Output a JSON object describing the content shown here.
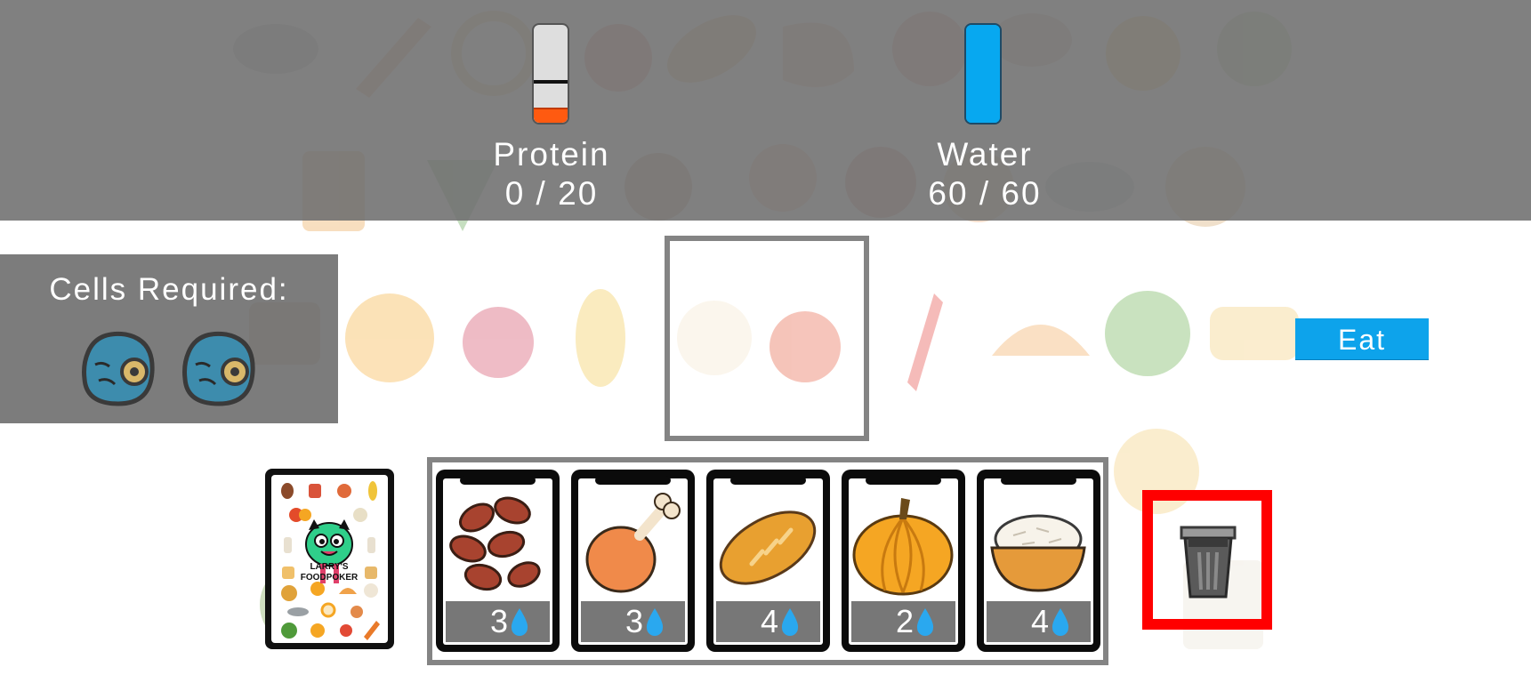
{
  "hud": {
    "protein": {
      "label": "Protein",
      "value_text": "0 / 20",
      "current": 0,
      "max": 20,
      "fill_fraction": 0.14,
      "target_marker_fraction": 0.56,
      "color": "#ff5a10"
    },
    "water": {
      "label": "Water",
      "value_text": "60 / 60",
      "current": 60,
      "max": 60,
      "fill_fraction": 1.0,
      "color": "#07a8f0"
    }
  },
  "cells_required": {
    "title": "Cells Required:",
    "icons": [
      "cell-icon",
      "cell-icon"
    ]
  },
  "play_area": {
    "icon": "empty-card-slot"
  },
  "eat_button": {
    "label": "Eat",
    "color": "#0da3eb"
  },
  "deck": {
    "logo_text_line1": "LARRY'S",
    "logo_text_line2": "FOODPOKER"
  },
  "hand": [
    {
      "food_icon": "kidney-beans-icon",
      "cost": "3",
      "cost_icon": "water-drop-icon"
    },
    {
      "food_icon": "chicken-drumstick-icon",
      "cost": "3",
      "cost_icon": "water-drop-icon"
    },
    {
      "food_icon": "bread-loaf-icon",
      "cost": "4",
      "cost_icon": "water-drop-icon"
    },
    {
      "food_icon": "pumpkin-icon",
      "cost": "2",
      "cost_icon": "water-drop-icon"
    },
    {
      "food_icon": "rice-bowl-icon",
      "cost": "4",
      "cost_icon": "water-drop-icon"
    }
  ],
  "discard": {
    "icon": "trash-can-icon",
    "highlight_color": "#ff0000"
  }
}
